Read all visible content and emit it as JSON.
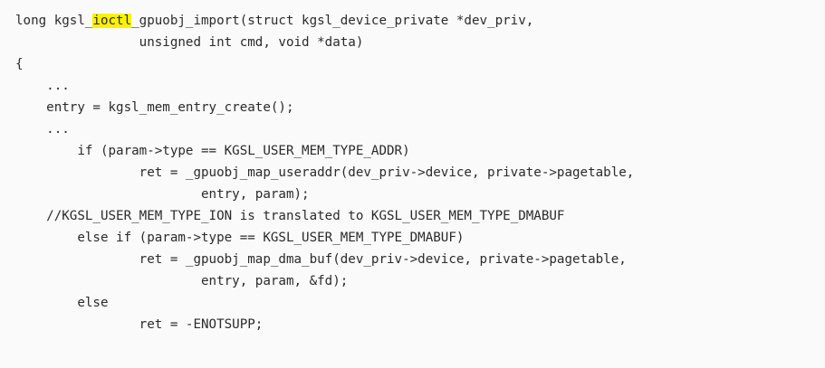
{
  "code": {
    "line_01": {
      "before": "long kgsl_",
      "highlight": "ioctl",
      "after": "_gpuobj_import(struct kgsl_device_private *dev_priv,"
    },
    "line_02": "                unsigned int cmd, void *data)",
    "line_03": "{",
    "line_04": "    ...",
    "line_05": "    entry = kgsl_mem_entry_create();",
    "line_06": "    ...",
    "line_07": "        if (param->type == KGSL_USER_MEM_TYPE_ADDR)",
    "line_08": "                ret = _gpuobj_map_useraddr(dev_priv->device, private->pagetable,",
    "line_09": "                        entry, param);",
    "line_10": "    //KGSL_USER_MEM_TYPE_ION is translated to KGSL_USER_MEM_TYPE_DMABUF",
    "line_11": "        else if (param->type == KGSL_USER_MEM_TYPE_DMABUF)",
    "line_12": "                ret = _gpuobj_map_dma_buf(dev_priv->device, private->pagetable,",
    "line_13": "                        entry, param, &fd);",
    "line_14": "        else",
    "line_15": "                ret = -ENOTSUPP;"
  },
  "colors": {
    "background": "#fafafa",
    "text": "#2b2b2b",
    "highlight": "#fff200"
  }
}
